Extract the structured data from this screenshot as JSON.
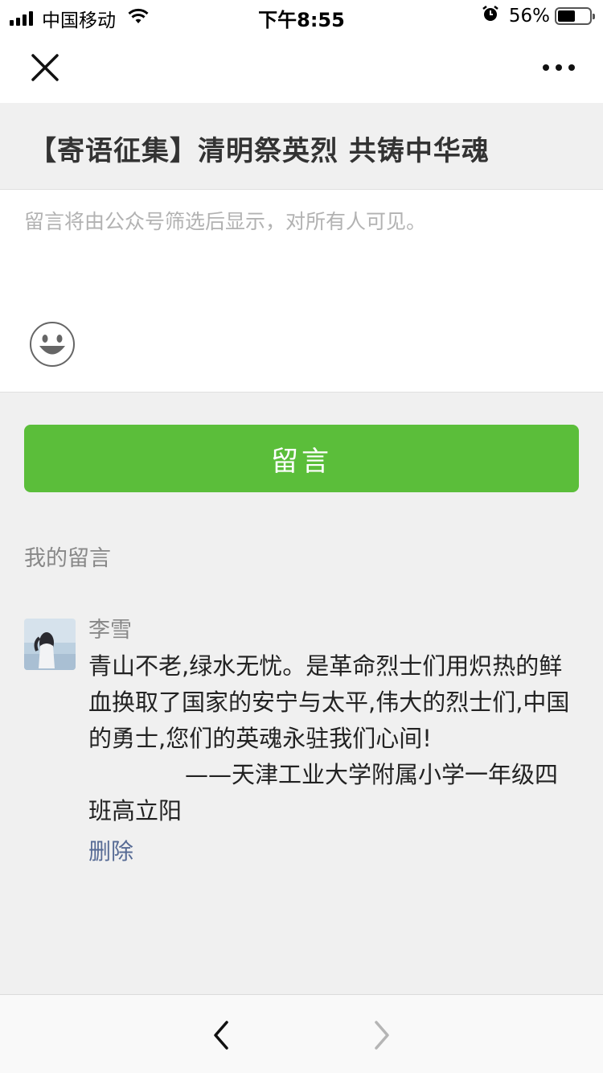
{
  "status_bar": {
    "carrier": "中国移动",
    "time": "下午8:55",
    "battery_percent": "56%",
    "battery_level": 0.56,
    "icons": [
      "signal-icon",
      "wifi-icon",
      "alarm-icon",
      "battery-icon"
    ]
  },
  "navbar": {
    "close_icon": "close-icon",
    "more_icon": "more-icon"
  },
  "article": {
    "title": "【寄语征集】清明祭英烈 共铸中华魂"
  },
  "compose": {
    "placeholder": "留言将由公众号筛选后显示，对所有人可见。",
    "value": "",
    "emoji_icon": "emoji-icon"
  },
  "submit_button": {
    "label": "留言",
    "color": "#5bbe3a"
  },
  "my_comments": {
    "label": "我的留言",
    "items": [
      {
        "nickname": "李雪",
        "text": "青山不老,绿水无忧。是革命烈士们用炽热的鲜血换取了国家的安宁与太平,伟大的烈士们,中国的勇士,您们的英魂永驻我们心间!",
        "signature": "——天津工业大学附属小学一年级四班高立阳",
        "delete_label": "删除"
      }
    ]
  },
  "bottom_bar": {
    "back_icon": "chevron-left-icon",
    "forward_icon": "chevron-right-icon"
  },
  "colors": {
    "accent": "#5bbe3a",
    "link": "#576b95",
    "background": "#f0f0f0"
  }
}
